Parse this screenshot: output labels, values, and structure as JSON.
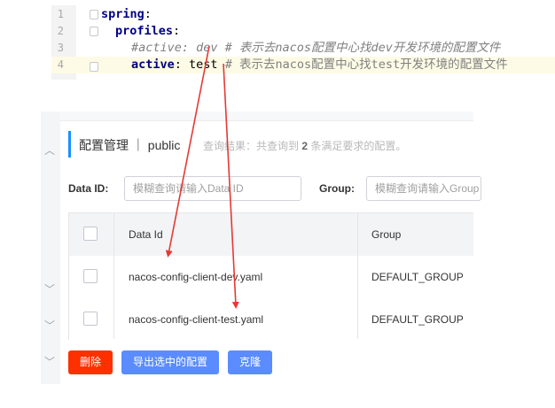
{
  "editor": {
    "lines": [
      {
        "num": "1",
        "key": "spring",
        "punct": ":"
      },
      {
        "num": "2",
        "key": "profiles",
        "punct": ":"
      },
      {
        "num": "3",
        "comment": "#active: dev # 表示去nacos配置中心找dev开发环境的配置文件"
      },
      {
        "num": "4",
        "key": "active",
        "punct": ":",
        "value": " test",
        "comment": " #  表示去nacos配置中心找test开发环境的配置文件"
      }
    ]
  },
  "panel": {
    "title": "配置管理 ｜ public",
    "result_prefix": "查询结果：共查询到 ",
    "result_count": "2",
    "result_suffix": " 条满足要求的配置。",
    "filters": {
      "data_id_label": "Data ID:",
      "data_id_placeholder": "模糊查询请输入Data ID",
      "group_label": "Group:",
      "group_placeholder": "模糊查询请输入Group"
    },
    "table": {
      "columns": [
        "Data Id",
        "Group"
      ],
      "rows": [
        {
          "data_id": "nacos-config-client-dev.yaml",
          "group": "DEFAULT_GROUP"
        },
        {
          "data_id": "nacos-config-client-test.yaml",
          "group": "DEFAULT_GROUP"
        }
      ]
    },
    "buttons": {
      "delete": "删除",
      "export": "导出选中的配置",
      "clone": "克隆"
    }
  },
  "colors": {
    "accent": "#1890ff",
    "delete": "#ff3000",
    "primary": "#5a8cff",
    "arrow": "#e53935"
  },
  "icons": [
    "chevron-up-icon",
    "chevron-down-icon",
    "fold-marker-icon",
    "checkbox-icon"
  ]
}
